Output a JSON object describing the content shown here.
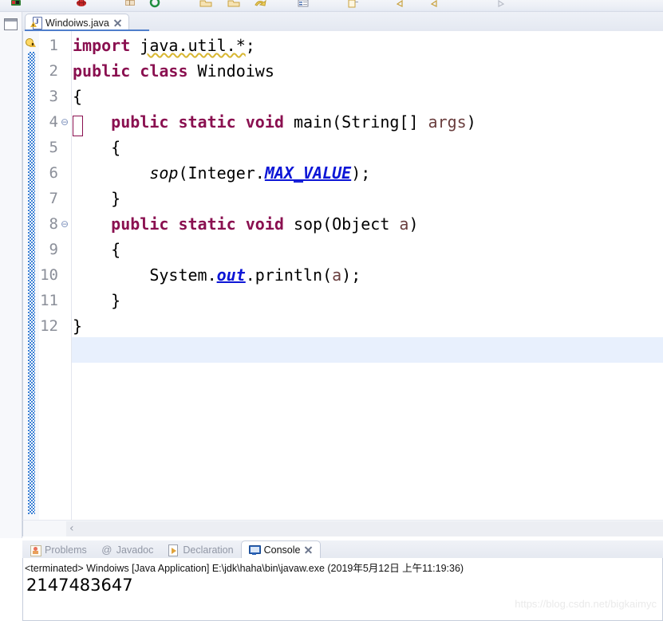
{
  "window": {
    "toolbar_icons": [
      "run-icon",
      "debug-icon",
      "open-type-icon",
      "search-icon",
      "new-folder-icon",
      "open-folder-icon",
      "save-all-icon",
      "properties-icon",
      "new-element-icon",
      "back-icon",
      "forward-icon",
      "next-annotation-icon"
    ]
  },
  "left_bar": {
    "restore_icon": "restore-view-icon"
  },
  "editor": {
    "tab": {
      "title": "Windoiws.java",
      "file_icon": "java-file-icon",
      "warning_overlay_icon": "warning-triangle-icon",
      "close_icon": "close-icon"
    },
    "annotation_ruler": {
      "warning_marker_icon": "warning-lightbulb-icon",
      "change_bar": "changed-lines-bar"
    },
    "lines": [
      {
        "n": "1",
        "fold": "",
        "html": "<span class=\"kw\">import</span> <span class=\"warnunderline\">java.util.*</span>;"
      },
      {
        "n": "2",
        "fold": "",
        "html": "<span class=\"kw\">public class</span> Windoiws"
      },
      {
        "n": "3",
        "fold": "",
        "html": "{"
      },
      {
        "n": "4",
        "fold": "⊖",
        "html": "    <span class=\"kw\">public static void</span> main(String[] <span class=\"param\">args</span>)"
      },
      {
        "n": "5",
        "fold": "",
        "html": "    {"
      },
      {
        "n": "6",
        "fold": "",
        "html": "        <span class=\"statmeth\">sop</span>(Integer.<span class=\"statfield\">MAX_VALUE</span>);"
      },
      {
        "n": "7",
        "fold": "",
        "html": "    }"
      },
      {
        "n": "8",
        "fold": "⊖",
        "html": "    <span class=\"kw\">public static void</span> sop(Object <span class=\"param\">a</span>)"
      },
      {
        "n": "9",
        "fold": "",
        "html": "    {"
      },
      {
        "n": "10",
        "fold": "",
        "html": "        System.<span class=\"statfield\">out</span>.println(<span class=\"param\">a</span>);"
      },
      {
        "n": "11",
        "fold": "",
        "html": "    }"
      },
      {
        "n": "12",
        "fold": "",
        "html": "}"
      }
    ],
    "source_text": "import java.util.*;\npublic class Windoiws\n{\n    public static void main(String[] args)\n    {\n        sop(Integer.MAX_VALUE);\n    }\n    public static void sop(Object a)\n    {\n        System.out.println(a);\n    }\n}",
    "current_line": "12",
    "scroll_left_arrow": "‹",
    "colors": {
      "keyword": "#8a1050",
      "static_field": "#0d16d6",
      "parameter": "#6a3e3e",
      "current_line_highlight": "#e8f0fd",
      "change_bar": "#3a7fd5"
    }
  },
  "console_view": {
    "tabs": [
      {
        "label": "Problems",
        "icon": "problems-icon",
        "active": false,
        "closeable": false
      },
      {
        "label": "Javadoc",
        "icon": "javadoc-icon",
        "active": false,
        "closeable": false
      },
      {
        "label": "Declaration",
        "icon": "declaration-icon",
        "active": false,
        "closeable": false
      },
      {
        "label": "Console",
        "icon": "console-icon",
        "active": true,
        "closeable": true
      }
    ],
    "close_icon": "close-icon",
    "terminated_line": "<terminated> Windoiws [Java Application] E:\\jdk\\haha\\bin\\javaw.exe (2019年5月12日 上午11:19:36)",
    "output": "2147483647"
  },
  "watermark": "https://blog.csdn.net/bigkaimyc"
}
